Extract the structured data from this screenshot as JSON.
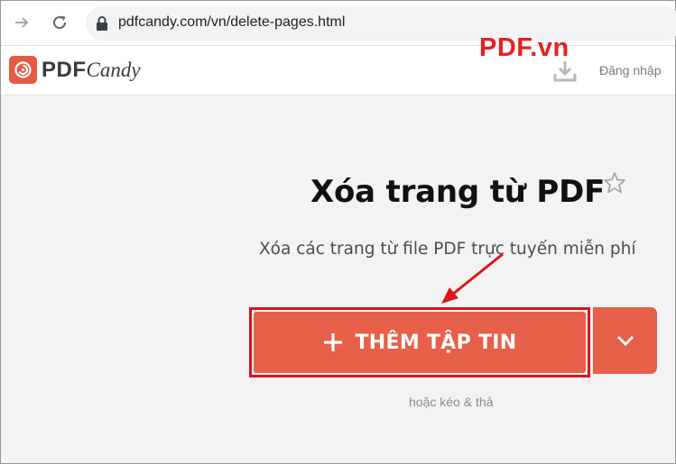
{
  "browser": {
    "url": "pdfcandy.com/vn/delete-pages.html",
    "icons": [
      "forward-arrow-icon",
      "reload-icon",
      "lock-icon"
    ]
  },
  "header": {
    "logo_text": "PDF",
    "logo_script": "Candy",
    "watermark": "PDF.vn",
    "login_label": "Đăng nhập",
    "icons": [
      "download-icon"
    ]
  },
  "main": {
    "title": "Xóa trang từ PDF",
    "subtitle": "Xóa các trang từ file PDF trực tuyến miễn phí",
    "add_file_label": "THÊM TẬP TIN",
    "drag_hint": "hoặc kéo & thả",
    "icons": [
      "star-icon",
      "plus-icon",
      "chevron-down-icon"
    ]
  },
  "colors": {
    "accent": "#e6604a",
    "highlight": "#e1131b",
    "watermark": "#e8201f"
  }
}
